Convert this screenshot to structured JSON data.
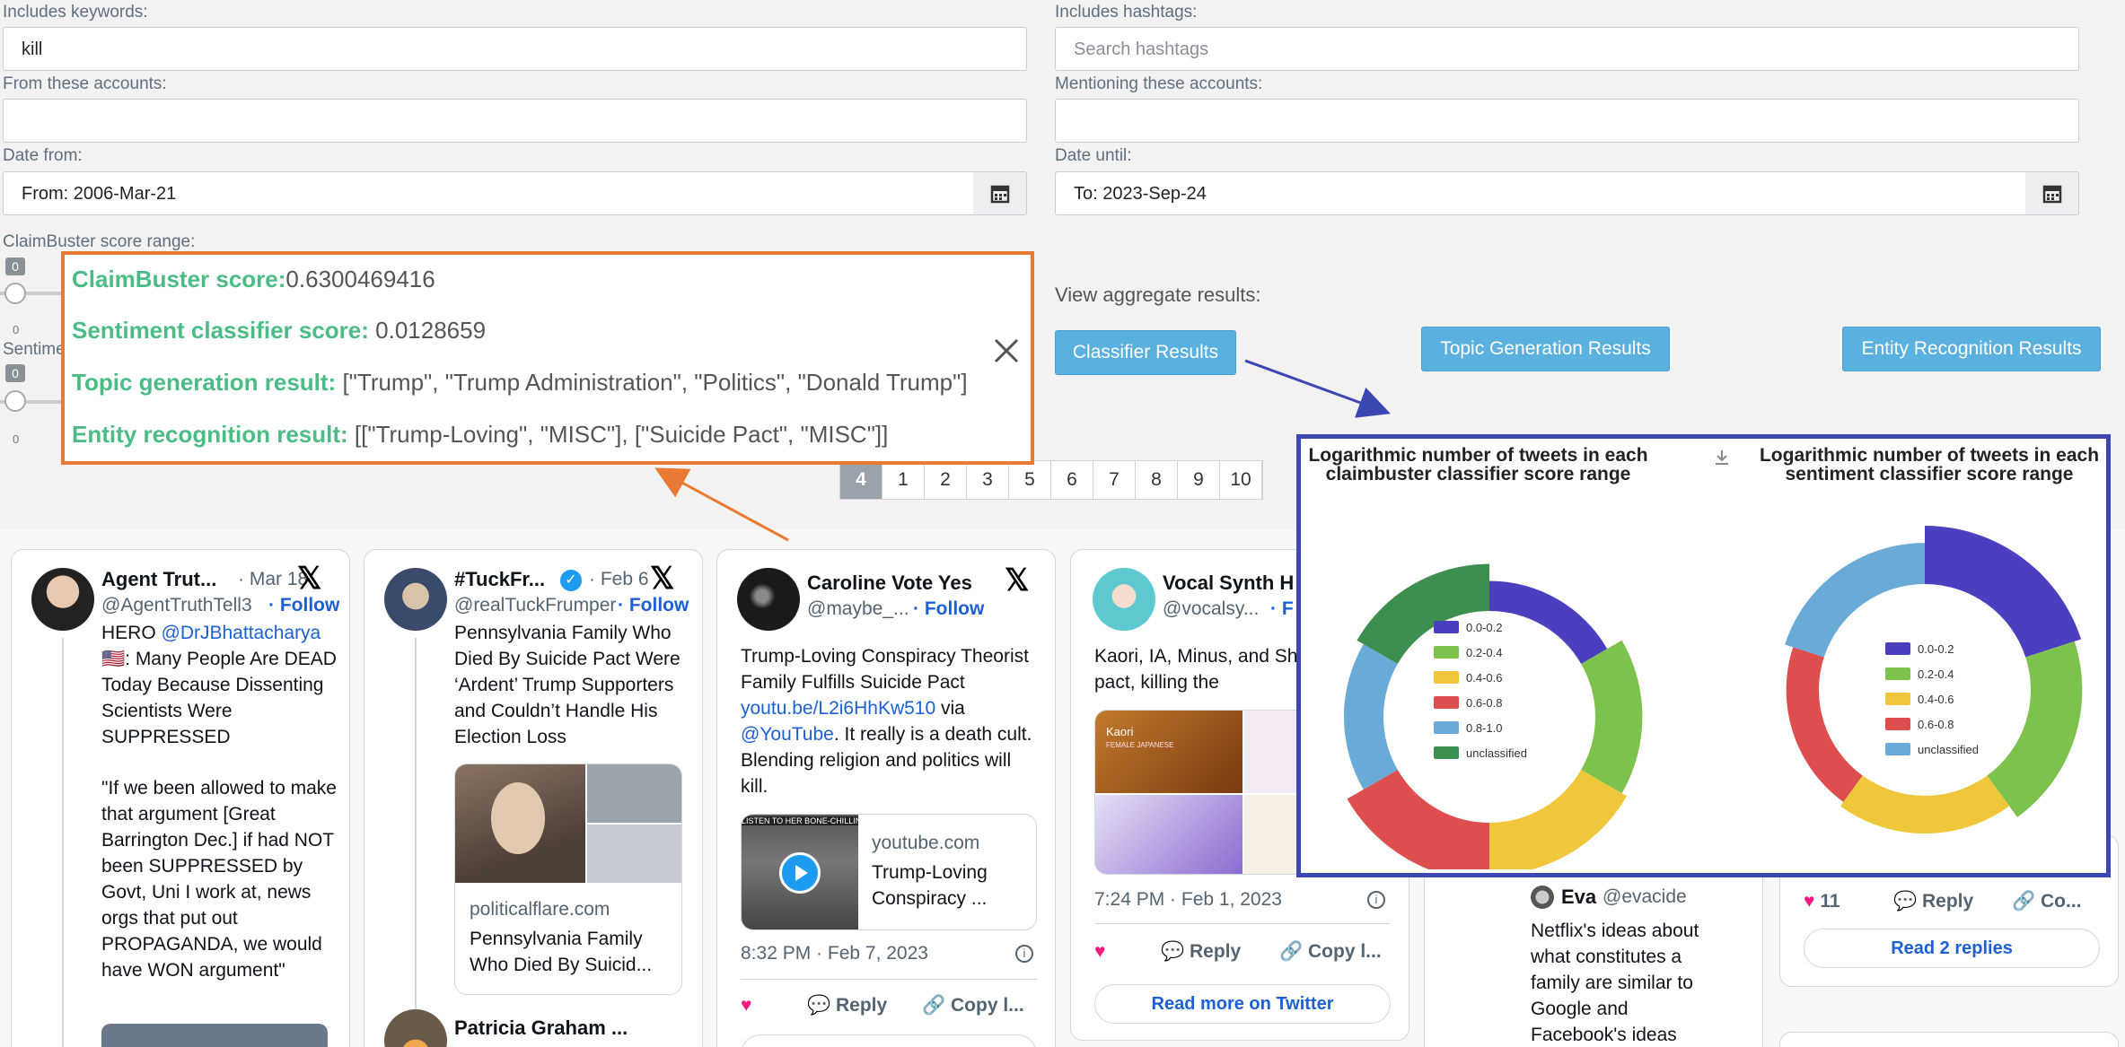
{
  "filters": {
    "keywords_label": "Includes keywords:",
    "keywords_value": "kill",
    "hashtags_label": "Includes hashtags:",
    "hashtags_placeholder": "Search hashtags",
    "accounts_label": "From these accounts:",
    "mentioning_label": "Mentioning these accounts:",
    "date_from_label": "Date from:",
    "date_from_value": "From: 2006-Mar-21",
    "date_until_label": "Date until:",
    "date_until_value": "To: 2023-Sep-24",
    "claimbuster_label": "ClaimBuster score range:",
    "sentiment_label": "Sentime",
    "slider1_badge": "0",
    "slider2_badge": "0",
    "tick0": "0",
    "tick1": "0"
  },
  "aggregate": {
    "label": "View aggregate results:",
    "classifier_btn": "Classifier Results",
    "topic_btn": "Topic Generation Results",
    "entity_btn": "Entity Recognition Results"
  },
  "pagination": [
    "«",
    "1",
    "2",
    "3",
    "4",
    "5",
    "6",
    "7",
    "8",
    "9",
    "10"
  ],
  "popup": {
    "cb_key": "ClaimBuster score:",
    "cb_val": "0.6300469416",
    "sent_key": "Sentiment classifier score:",
    "sent_val": " 0.0128659",
    "topic_key": "Topic generation result:",
    "topic_val": " [\"Trump\", \"Trump Administration\", \"Politics\", \"Donald Trump\"]",
    "entity_key": "Entity recognition result:",
    "entity_val": " [[\"Trump-Loving\", \"MISC\"], [\"Suicide Pact\", \"MISC\"]]"
  },
  "tweets": [
    {
      "name": "Agent Trut...",
      "date": "· Mar 18",
      "handle": "@AgentTruthTell3",
      "follow": "· Follow",
      "text_a": "HERO ",
      "text_link": "@DrJBhattacharya",
      "text_b": "🇺🇸: Many People Are DEAD Today Because Dissenting Scientists Were SUPPRESSED",
      "text_c": "\"If we been allowed to make that argument [Great Barrington Dec.] if had NOT been SUPPRESSED by Govt, Uni I work at, news orgs that put out PROPAGANDA, we would have WON argument\""
    },
    {
      "name": "#TuckFr...",
      "date": "· Feb 6",
      "handle": "@realTuckFrumper",
      "follow": "· Follow",
      "text": "Pennsylvania Family Who Died By Suicide Pact Were ‘Ardent’ Trump Supporters and Couldn’t Handle His Election Loss",
      "card_domain": "politicalflare.com",
      "card_title": "Pennsylvania Family Who Died By Suicid...",
      "next_name": "Patricia Graham ..."
    },
    {
      "name": "Caroline Vote Yes",
      "handle": "@maybe_...",
      "follow": "· Follow",
      "text_a": "Trump-Loving Conspiracy Theorist Family Fulfills Suicide Pact ",
      "text_link": "youtu.be/L2i6HhKw510",
      "text_b": " via ",
      "text_link2": "@YouTube",
      "text_c": ".                 It really is a death cult. Blending religion and politics will kill.",
      "card_domain": "youtube.com",
      "card_title": "Trump-Loving Conspiracy ...",
      "thumb_text": "LISTEN TO HER BONE-CHILLING",
      "time": "8:32 PM · Feb 7, 2023",
      "reply": "Reply",
      "copy": "Copy l..."
    },
    {
      "name": "Vocal Synth H",
      "handle": "@vocalsy...",
      "follow": "· F",
      "text": "Kaori, IA, Minus, and Sh suicide pact, killing the",
      "img_label": "Kaori",
      "img_sub": "FEMALE JAPANESE",
      "time": "7:24 PM · Feb 1, 2023",
      "reply": "Reply",
      "copy": "Copy l...",
      "read_more": "Read more on Twitter"
    },
    {
      "name": "Eva",
      "handle": "@evacide",
      "text": "Netflix's ideas about what constitutes a family are similar to Google and Facebook's ideas"
    },
    {
      "likes": "11",
      "reply": "Reply",
      "copy": "Co...",
      "read_replies": "Read 2 replies"
    }
  ],
  "chart_data": [
    {
      "type": "pie",
      "title": "Logarithmic number of tweets in each claimbuster classifier score range",
      "categories": [
        "0.0-0.2",
        "0.2-0.4",
        "0.4-0.6",
        "0.6-0.8",
        "0.8-1.0",
        "unclassified"
      ],
      "values": [
        0.8,
        1.25,
        1.4,
        1.55,
        1.05,
        1.25
      ],
      "colors": [
        "#4a3fbf",
        "#7ec24e",
        "#f0c63a",
        "#df4e4e",
        "#6aaad6",
        "#3d8f4f"
      ],
      "legend": "center"
    },
    {
      "type": "pie",
      "title": "Logarithmic number of tweets in each sentiment classifier score range",
      "categories": [
        "0.0-0.2",
        "0.2-0.4",
        "0.4-0.6",
        "0.6-0.8",
        "unclassified"
      ],
      "values": [
        1.7,
        1.5,
        1.1,
        0.95,
        1.2
      ],
      "colors": [
        "#4a3fbf",
        "#7ec24e",
        "#f0c63a",
        "#df4e4e",
        "#6aaad6"
      ],
      "legend": "center"
    }
  ]
}
